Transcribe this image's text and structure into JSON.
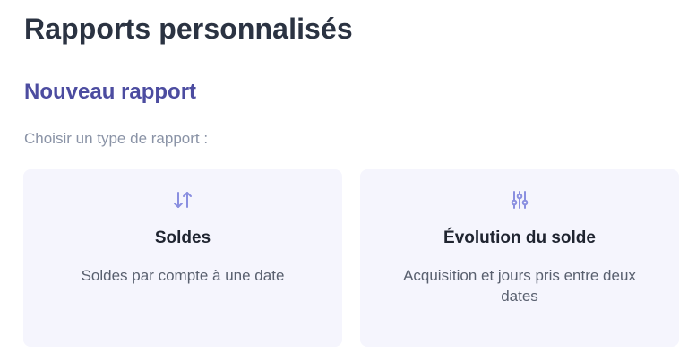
{
  "page": {
    "title": "Rapports personnalisés"
  },
  "section": {
    "title": "Nouveau rapport",
    "prompt": "Choisir un type de rapport :"
  },
  "cards": [
    {
      "icon": "sort-arrows-icon",
      "title": "Soldes",
      "description": "Soldes par compte à une date"
    },
    {
      "icon": "sliders-icon",
      "title": "Évolution du solde",
      "description": "Acquisition et jours pris entre deux dates"
    }
  ],
  "colors": {
    "accent": "#4c4ca0",
    "icon": "#8a8fe0",
    "card_bg": "#f5f5fd"
  }
}
